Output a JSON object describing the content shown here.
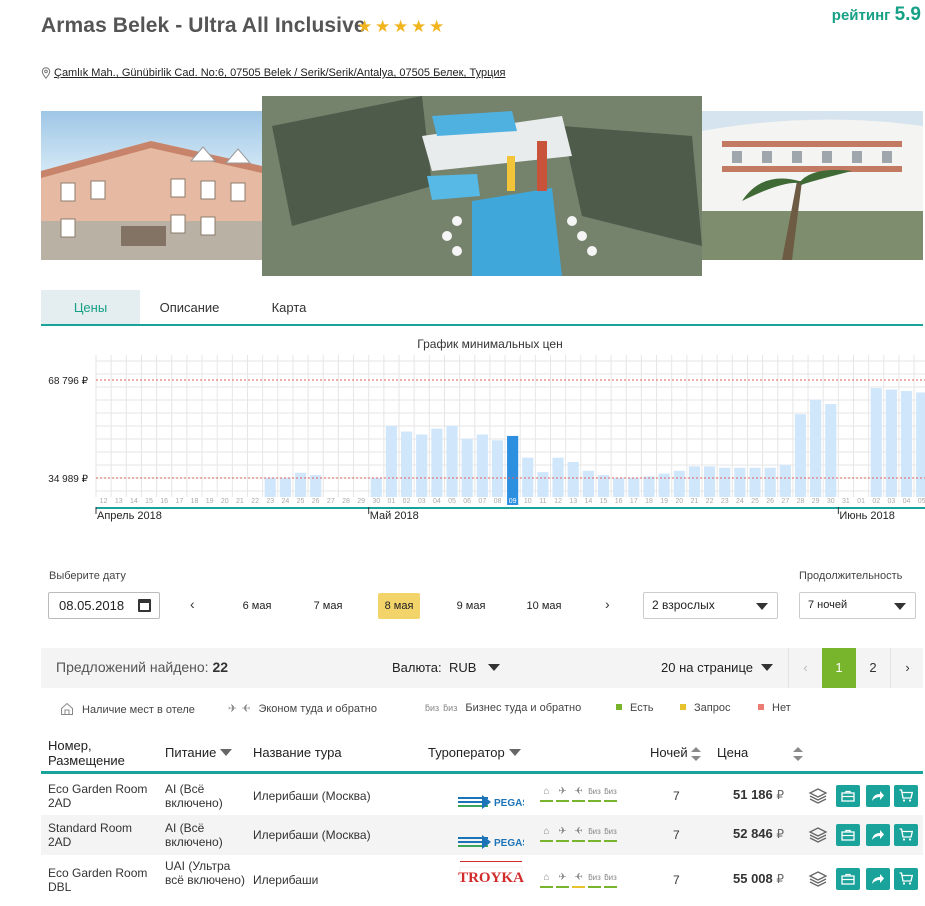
{
  "hotel": {
    "title": "Armas Belek - Ultra All Inclusive",
    "stars": 5,
    "rating_label": "рейтинг",
    "rating_value": "5.9",
    "address": "Çamlık Mah., Günübirlik Cad. No:6, 07505 Belek / Serik/Serik/Antalya, 07505 Белек, Турция"
  },
  "tabs": [
    {
      "label": "Цены",
      "active": true
    },
    {
      "label": "Описание",
      "active": false
    },
    {
      "label": "Карта",
      "active": false
    }
  ],
  "chart_data": {
    "type": "bar",
    "title": "График минимальных цен",
    "y_tick_labels": [
      "68 796 ₽",
      "34 989 ₽"
    ],
    "y_ticks": [
      68796,
      34989
    ],
    "ylim": [
      30000,
      75000
    ],
    "months": [
      {
        "label": "Апрель 2018",
        "start_index": 0
      },
      {
        "label": "Май 2018",
        "start_index": 18
      },
      {
        "label": "Июнь 2018",
        "start_index": 49
      }
    ],
    "days": [
      "12",
      "13",
      "14",
      "15",
      "16",
      "17",
      "18",
      "19",
      "20",
      "21",
      "22",
      "23",
      "24",
      "25",
      "26",
      "27",
      "28",
      "29",
      "30",
      "01",
      "02",
      "03",
      "04",
      "05",
      "06",
      "07",
      "08",
      "09",
      "10",
      "11",
      "12",
      "13",
      "14",
      "15",
      "16",
      "17",
      "18",
      "19",
      "20",
      "21",
      "22",
      "23",
      "24",
      "25",
      "26",
      "27",
      "28",
      "29",
      "30",
      "31",
      "01",
      "02",
      "03",
      "04",
      "05",
      "06",
      "07",
      "08"
    ],
    "values": [
      null,
      null,
      null,
      null,
      null,
      null,
      null,
      null,
      null,
      null,
      null,
      34989,
      34989,
      36800,
      36000,
      null,
      null,
      null,
      34989,
      53000,
      51000,
      50000,
      52000,
      53000,
      48500,
      50000,
      48000,
      49500,
      42000,
      37000,
      42000,
      40500,
      37500,
      36000,
      34989,
      34989,
      35500,
      36500,
      37500,
      39000,
      39000,
      38500,
      38500,
      38500,
      38500,
      39500,
      57000,
      62000,
      60500,
      null,
      null,
      66000,
      65500,
      65000,
      64500,
      64000,
      63500,
      63000
    ],
    "selected_index": 27,
    "grid": true
  },
  "controls": {
    "date_label": "Выберите дату",
    "date_value": "08.05.2018",
    "date_chips": [
      "6 мая",
      "7 мая",
      "8 мая",
      "9 мая",
      "10 мая"
    ],
    "selected_chip": "8 мая",
    "adults": "2 взрослых",
    "duration_label": "Продолжительность",
    "duration": "7 ночей"
  },
  "results": {
    "found_label": "Предложений найдено:",
    "found_count": "22",
    "currency_label": "Валюта:",
    "currency": "RUB",
    "per_page": "20 на странице",
    "pages": [
      "1",
      "2"
    ],
    "current_page": "1"
  },
  "legend": {
    "hotel_places": "Наличие мест в отеле",
    "economy": "Эконом туда и обратно",
    "business": "Бизнес туда и обратно",
    "yes": "Есть",
    "request": "Запрос",
    "no": "Нет",
    "colors": {
      "yes": "#79b52c",
      "request": "#e6c22d",
      "no": "#ec7b72"
    }
  },
  "table": {
    "headers": {
      "room": "Номер,\nРазмещение",
      "meal": "Питание",
      "tour": "Название тура",
      "operator": "Туроператор",
      "nights": "Ночей",
      "price": "Цена"
    },
    "rows": [
      {
        "room": "Eco Garden Room 2AD",
        "meal": "AI (Всё включено)",
        "tour": "Илерибаши (Москва)",
        "operator": "PEGAS",
        "nights": "7",
        "price": "51 186",
        "currency": "₽"
      },
      {
        "room": "Standard Room 2AD",
        "meal": "AI (Всё включено)",
        "tour": "Илерибаши (Москва)",
        "operator": "PEGAS",
        "nights": "7",
        "price": "52 846",
        "currency": "₽"
      },
      {
        "room": "Eco Garden Room DBL",
        "meal": "UAI (Ультра всё включено)",
        "tour": "Илерибаши",
        "operator": "TROYKA",
        "nights": "7",
        "price": "55 008",
        "currency": "₽"
      }
    ]
  }
}
